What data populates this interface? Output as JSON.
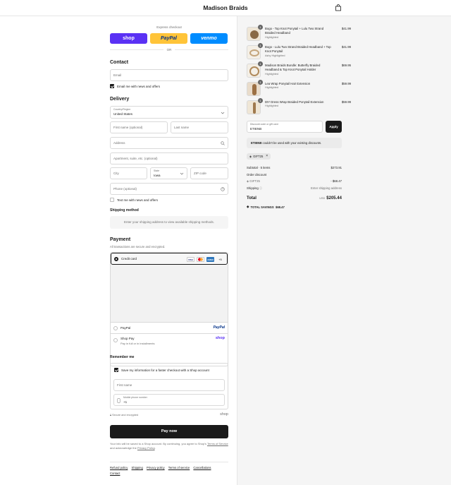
{
  "header": {
    "store_name": "Madison Braids"
  },
  "express": {
    "label": "Express checkout",
    "shop": "shop",
    "paypal": "PayPal",
    "venmo": "venmo",
    "or": "OR"
  },
  "contact": {
    "title": "Contact",
    "email_placeholder": "Email",
    "news_label": "Email me with news and offers"
  },
  "delivery": {
    "title": "Delivery",
    "country_label": "Country/Region",
    "country_value": "United States",
    "first_name": "First name (optional)",
    "last_name": "Last name",
    "address": "Address",
    "apartment": "Apartment, suite, etc. (optional)",
    "city": "City",
    "state_label": "State",
    "state_value": "Iowa",
    "zip": "ZIP code",
    "phone": "Phone (optional)",
    "text_label": "Text me with news and offers"
  },
  "shipping": {
    "title": "Shipping method",
    "note": "Enter your shipping address to view available shipping methods."
  },
  "payment": {
    "title": "Payment",
    "note": "All transactions are secure and encrypted.",
    "credit_card": "Credit card",
    "card_visa": "VISA",
    "card_amex": "AMEX",
    "card_more": "+5",
    "paypal": "PayPal",
    "paypal_logo": "PayPal",
    "shop_pay": "Shop Pay",
    "shop_pay_sub": "Pay in full or in installments",
    "shop_logo": "shop"
  },
  "remember": {
    "title": "Remember me",
    "save_label": "Save my information for a faster checkout with a Shop account",
    "first_name": "First name",
    "mobile_label": "Mobile phone number",
    "mobile_value": "+1",
    "secure": "Secure and encrypted",
    "shop_mark": "shop"
  },
  "pay_now": "Pay now",
  "terms": {
    "text1": "Your info will be saved to a Shop account. By continuing, you agree to Shop's",
    "tos": "Terms of Service",
    "text2": "and acknowledge the",
    "privacy": "Privacy Policy",
    "text3": "."
  },
  "footer": [
    "Refund policy",
    "Shipping",
    "Privacy policy",
    "Terms of service",
    "Cancellations",
    "Contact"
  ],
  "cart": {
    "items": [
      {
        "qty": "1",
        "name": "Bogo - Top Knot Ponytail + Lulu Two Strand Braided Headband",
        "variant": "Highlighted",
        "price": "$41.99"
      },
      {
        "qty": "1",
        "name": "Bogo - Lulu Two Strand Braided Headband + Top Knot Ponytail",
        "variant": "Ashy Highlighted",
        "price": "$41.99"
      },
      {
        "qty": "1",
        "name": "Madison Braids Bundle: Butterfly Braided Headband & Top Knot Ponytail Holder",
        "variant": "Highlighted",
        "price": "$69.95"
      },
      {
        "qty": "1",
        "name": "Lea Wrap Ponytail Hair Extension",
        "variant": "Highlighted",
        "price": "$59.99"
      },
      {
        "qty": "1",
        "name": "DIY Dress Wrap Braided Ponytail Extension",
        "variant": "Highlighted",
        "price": "$59.99"
      }
    ],
    "discount_label": "Discount code or gift card",
    "discount_value": "ETIENB",
    "apply": "Apply",
    "error_code": "ETIENB",
    "error_text": "couldn't be used with your existing discounts.",
    "chip": "GIFT25",
    "subtotal_label": "Subtotal · 5 items",
    "subtotal_value": "$273.91",
    "order_discount": "Order discount",
    "discount_code": "GIFT25",
    "discount_amount": "- $68.47",
    "shipping_label": "Shipping",
    "shipping_value": "Enter shipping address",
    "total_label": "Total",
    "currency": "USD",
    "total_value": "$205.44",
    "savings": "TOTAL SAVINGS  $68.47"
  },
  "colors": {
    "shop": "#5a31f4",
    "paypal": "#ffc439",
    "venmo": "#008cff",
    "primary": "#1a1a1a"
  }
}
